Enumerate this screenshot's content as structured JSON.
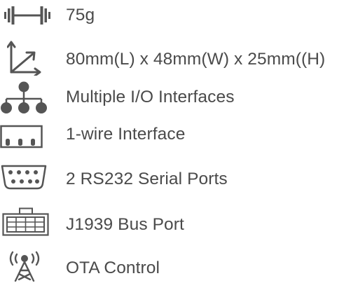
{
  "specs": [
    {
      "icon": "dumbbell-icon",
      "label": "75g"
    },
    {
      "icon": "dimensions-axes-icon",
      "label": "80mm(L) x 48mm(W) x 25mm((H)"
    },
    {
      "icon": "network-hierarchy-icon",
      "label": "Multiple I/O Interfaces"
    },
    {
      "icon": "one-wire-connector-icon",
      "label": "1-wire Interface"
    },
    {
      "icon": "serial-port-icon",
      "label": "2 RS232 Serial Ports"
    },
    {
      "icon": "bus-port-connector-icon",
      "label": "J1939 Bus Port"
    },
    {
      "icon": "radio-tower-icon",
      "label": "OTA Control"
    }
  ],
  "colors": {
    "icon": "#555555",
    "text": "#4a4a4a"
  }
}
